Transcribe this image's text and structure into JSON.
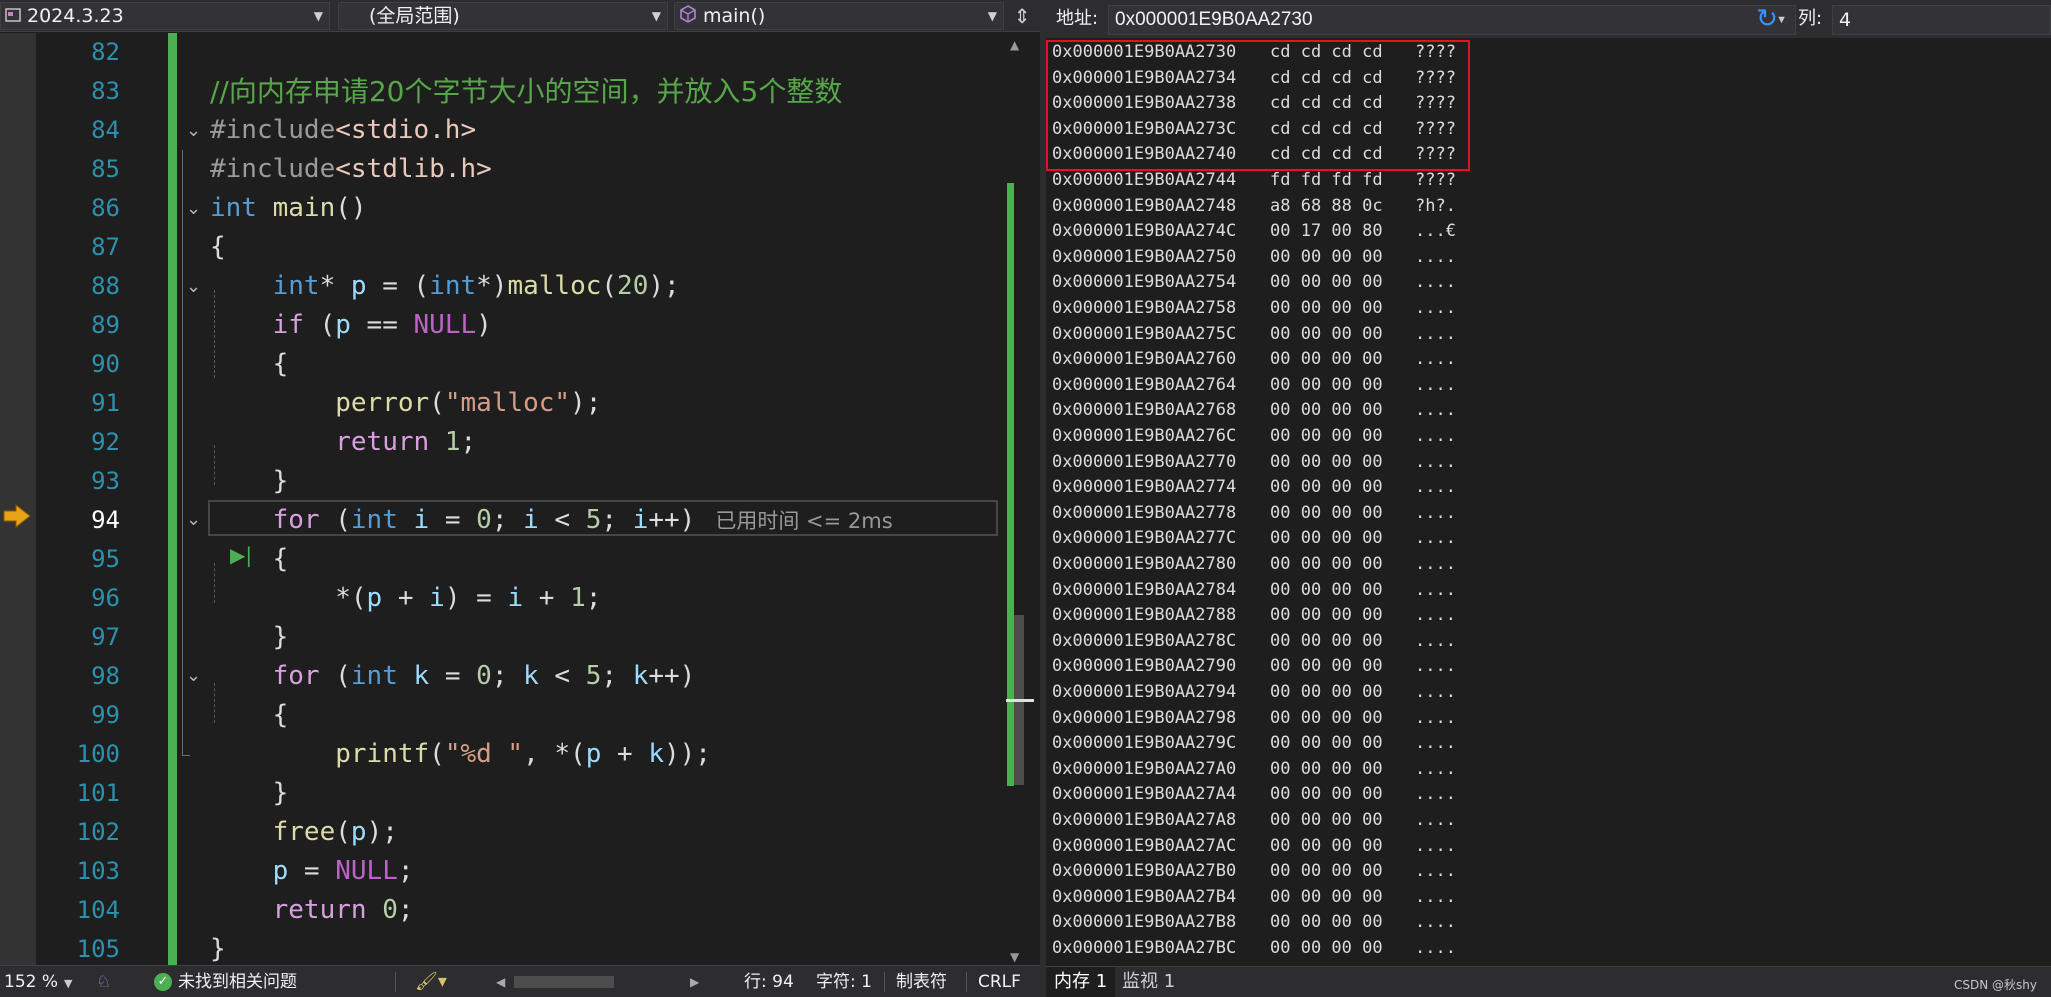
{
  "nav": {
    "project": "2024.3.23",
    "scope": "(全局范围)",
    "function": "main()"
  },
  "editor": {
    "line_numbers": [
      "82",
      "83",
      "84",
      "85",
      "86",
      "87",
      "88",
      "89",
      "90",
      "91",
      "92",
      "93",
      "94",
      "95",
      "96",
      "97",
      "98",
      "99",
      "100",
      "101",
      "102",
      "103",
      "104",
      "105"
    ],
    "current_line": "94",
    "perf_tip": "已用时间 <= 2ms",
    "code": {
      "l83": "//向内存申请20个字节大小的空间，并放入5个整数",
      "l84_pp": "#include",
      "l84_hdr": "<stdio.h>",
      "l85_pp": "#include",
      "l85_hdr": "<stdlib.h>",
      "int": "int",
      "main": "main",
      "malloc": "malloc",
      "n20": "20",
      "if": "if",
      "p": "p",
      "NULL": "NULL",
      "perror": "perror",
      "malloc_str": "\"malloc\"",
      "return": "return",
      "n1": "1",
      "n0": "0",
      "n5": "5",
      "for": "for",
      "i": "i",
      "k": "k",
      "printf": "printf",
      "fmt_str": "\"%d \"",
      "free": "free"
    }
  },
  "status": {
    "zoom": "152 %",
    "issues": "未找到相关问题",
    "line": "行: 94",
    "char": "字符: 1",
    "tab": "制表符",
    "eol": "CRLF"
  },
  "memory": {
    "address_label": "地址:",
    "address": "0x000001E9B0AA2730",
    "cols_label": "列:",
    "cols": "4",
    "rows": [
      {
        "addr": "0x000001E9B0AA2730",
        "bytes": "cd cd cd cd",
        "ascii": "????"
      },
      {
        "addr": "0x000001E9B0AA2734",
        "bytes": "cd cd cd cd",
        "ascii": "????"
      },
      {
        "addr": "0x000001E9B0AA2738",
        "bytes": "cd cd cd cd",
        "ascii": "????"
      },
      {
        "addr": "0x000001E9B0AA273C",
        "bytes": "cd cd cd cd",
        "ascii": "????"
      },
      {
        "addr": "0x000001E9B0AA2740",
        "bytes": "cd cd cd cd",
        "ascii": "????"
      },
      {
        "addr": "0x000001E9B0AA2744",
        "bytes": "fd fd fd fd",
        "ascii": "????"
      },
      {
        "addr": "0x000001E9B0AA2748",
        "bytes": "a8 68 88 0c",
        "ascii": "?h?."
      },
      {
        "addr": "0x000001E9B0AA274C",
        "bytes": "00 17 00 80",
        "ascii": "...€"
      },
      {
        "addr": "0x000001E9B0AA2750",
        "bytes": "00 00 00 00",
        "ascii": "...."
      },
      {
        "addr": "0x000001E9B0AA2754",
        "bytes": "00 00 00 00",
        "ascii": "...."
      },
      {
        "addr": "0x000001E9B0AA2758",
        "bytes": "00 00 00 00",
        "ascii": "...."
      },
      {
        "addr": "0x000001E9B0AA275C",
        "bytes": "00 00 00 00",
        "ascii": "...."
      },
      {
        "addr": "0x000001E9B0AA2760",
        "bytes": "00 00 00 00",
        "ascii": "...."
      },
      {
        "addr": "0x000001E9B0AA2764",
        "bytes": "00 00 00 00",
        "ascii": "...."
      },
      {
        "addr": "0x000001E9B0AA2768",
        "bytes": "00 00 00 00",
        "ascii": "...."
      },
      {
        "addr": "0x000001E9B0AA276C",
        "bytes": "00 00 00 00",
        "ascii": "...."
      },
      {
        "addr": "0x000001E9B0AA2770",
        "bytes": "00 00 00 00",
        "ascii": "...."
      },
      {
        "addr": "0x000001E9B0AA2774",
        "bytes": "00 00 00 00",
        "ascii": "...."
      },
      {
        "addr": "0x000001E9B0AA2778",
        "bytes": "00 00 00 00",
        "ascii": "...."
      },
      {
        "addr": "0x000001E9B0AA277C",
        "bytes": "00 00 00 00",
        "ascii": "...."
      },
      {
        "addr": "0x000001E9B0AA2780",
        "bytes": "00 00 00 00",
        "ascii": "...."
      },
      {
        "addr": "0x000001E9B0AA2784",
        "bytes": "00 00 00 00",
        "ascii": "...."
      },
      {
        "addr": "0x000001E9B0AA2788",
        "bytes": "00 00 00 00",
        "ascii": "...."
      },
      {
        "addr": "0x000001E9B0AA278C",
        "bytes": "00 00 00 00",
        "ascii": "...."
      },
      {
        "addr": "0x000001E9B0AA2790",
        "bytes": "00 00 00 00",
        "ascii": "...."
      },
      {
        "addr": "0x000001E9B0AA2794",
        "bytes": "00 00 00 00",
        "ascii": "...."
      },
      {
        "addr": "0x000001E9B0AA2798",
        "bytes": "00 00 00 00",
        "ascii": "...."
      },
      {
        "addr": "0x000001E9B0AA279C",
        "bytes": "00 00 00 00",
        "ascii": "...."
      },
      {
        "addr": "0x000001E9B0AA27A0",
        "bytes": "00 00 00 00",
        "ascii": "...."
      },
      {
        "addr": "0x000001E9B0AA27A4",
        "bytes": "00 00 00 00",
        "ascii": "...."
      },
      {
        "addr": "0x000001E9B0AA27A8",
        "bytes": "00 00 00 00",
        "ascii": "...."
      },
      {
        "addr": "0x000001E9B0AA27AC",
        "bytes": "00 00 00 00",
        "ascii": "...."
      },
      {
        "addr": "0x000001E9B0AA27B0",
        "bytes": "00 00 00 00",
        "ascii": "...."
      },
      {
        "addr": "0x000001E9B0AA27B4",
        "bytes": "00 00 00 00",
        "ascii": "...."
      },
      {
        "addr": "0x000001E9B0AA27B8",
        "bytes": "00 00 00 00",
        "ascii": "...."
      },
      {
        "addr": "0x000001E9B0AA27BC",
        "bytes": "00 00 00 00",
        "ascii": "...."
      }
    ],
    "tabs": [
      "内存 1",
      "监视 1"
    ],
    "watermark": "CSDN @秋shy"
  },
  "colors": {
    "change_bar": "#4cb050",
    "highlight_box": "#e81123",
    "line_number": "#2b91af",
    "exec_arrow": "#e8a317"
  },
  "icons": {
    "exec_arrow": "arrow-right-icon",
    "refresh": "refresh-icon",
    "issues": "check-circle-icon"
  }
}
